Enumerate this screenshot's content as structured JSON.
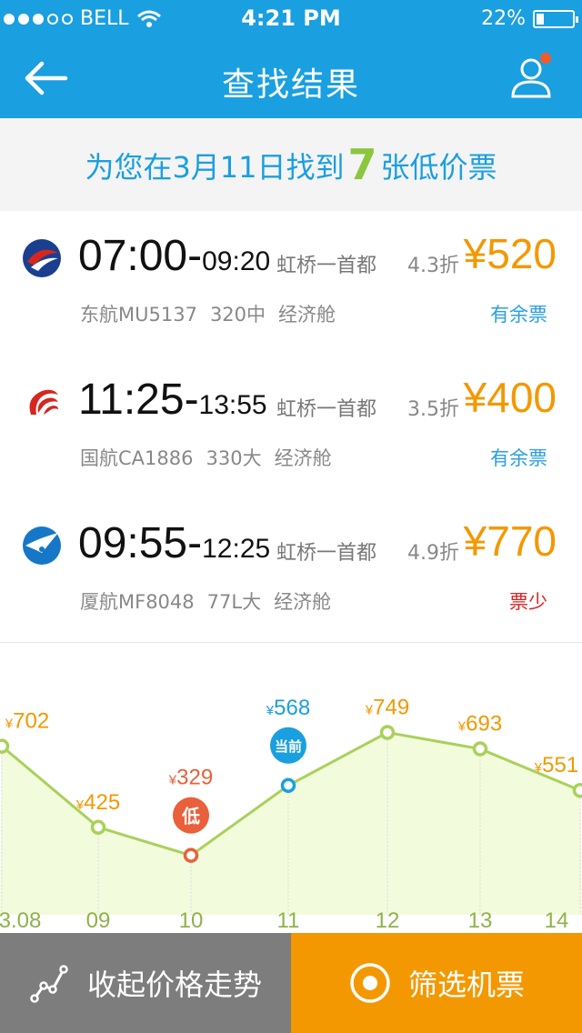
{
  "status_bar": {
    "carrier": "BELL",
    "time": "4:21 PM",
    "battery": "22%",
    "battery_level": 0.22
  },
  "nav": {
    "title": "查找结果"
  },
  "summary": {
    "prefix": "为您在3月11日找到",
    "count": "7",
    "suffix": "张低价票"
  },
  "flights": [
    {
      "airline": "东航",
      "airline_icon": "china-eastern-logo",
      "dep_time": "07:00",
      "arr_time": "09:20",
      "route": "虹桥一首都",
      "discount": "4.3折",
      "price": "¥520",
      "flight_no": "东航MU5137",
      "aircraft": "320中",
      "cabin": "经济舱",
      "ticket_status": "有余票",
      "status_color": "#2a9fe0"
    },
    {
      "airline": "国航",
      "airline_icon": "air-china-logo",
      "dep_time": "11:25",
      "arr_time": "13:55",
      "route": "虹桥一首都",
      "discount": "3.5折",
      "price": "¥400",
      "flight_no": "国航CA1886",
      "aircraft": "330大",
      "cabin": "经济舱",
      "ticket_status": "有余票",
      "status_color": "#2a9fe0"
    },
    {
      "airline": "厦航",
      "airline_icon": "xiamen-airlines-logo",
      "dep_time": "09:55",
      "arr_time": "12:25",
      "route": "虹桥一首都",
      "discount": "4.9折",
      "price": "¥770",
      "flight_no": "厦航MF8048",
      "aircraft": "77L大",
      "cabin": "经济舱",
      "ticket_status": "票少",
      "status_color": "#e02020"
    }
  ],
  "chart_data": {
    "type": "line",
    "x": [
      "3.08",
      "09",
      "10",
      "11",
      "12",
      "13",
      "14"
    ],
    "values": [
      702,
      425,
      329,
      568,
      749,
      693,
      551
    ],
    "value_labels": [
      "¥702",
      "¥425",
      "¥329",
      "¥568",
      "¥749",
      "¥693",
      "¥551"
    ],
    "lowest_index": 2,
    "lowest_badge": "低",
    "current_index": 3,
    "current_badge": "当前",
    "colors": {
      "line": "#a9d15a",
      "fill": "#f3fbdd",
      "label": "#f39800",
      "low": "#e9603a",
      "current": "#1a9fe0"
    }
  },
  "footer": {
    "trend_label": "收起价格走势",
    "filter_label": "筛选机票"
  },
  "colors": {
    "header": "#1a9fe0",
    "price": "#f39800",
    "trend_button": "#7d7d7d",
    "filter_button": "#f39800"
  }
}
